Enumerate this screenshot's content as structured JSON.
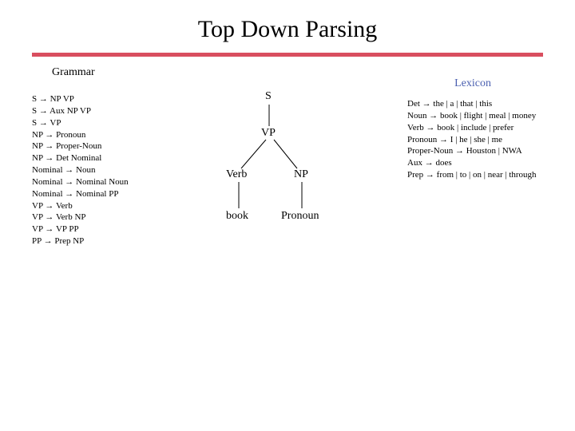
{
  "title": "Top Down Parsing",
  "grammar_label": "Grammar",
  "lexicon_label": "Lexicon",
  "grammar_rules": [
    "S → NP VP",
    "S → Aux NP VP",
    "S → VP",
    "NP → Pronoun",
    "NP → Proper-Noun",
    "NP → Det Nominal",
    "Nominal → Noun",
    "Nominal → Nominal Noun",
    "Nominal → Nominal PP",
    "VP → Verb",
    "VP → Verb NP",
    "VP → VP PP",
    "PP → Prep NP"
  ],
  "lexicon_rules": [
    "Det → the | a | that | this",
    "Noun → book | flight | meal | money",
    "Verb → book | include | prefer",
    "Pronoun → I | he | she | me",
    "Proper-Noun → Houston | NWA",
    "Aux → does",
    "Prep → from | to | on | near | through"
  ],
  "tree": {
    "root": "S",
    "l1": "VP",
    "l2a": "Verb",
    "l2b": "NP",
    "l3a": "book",
    "l3b": "Pronoun"
  }
}
